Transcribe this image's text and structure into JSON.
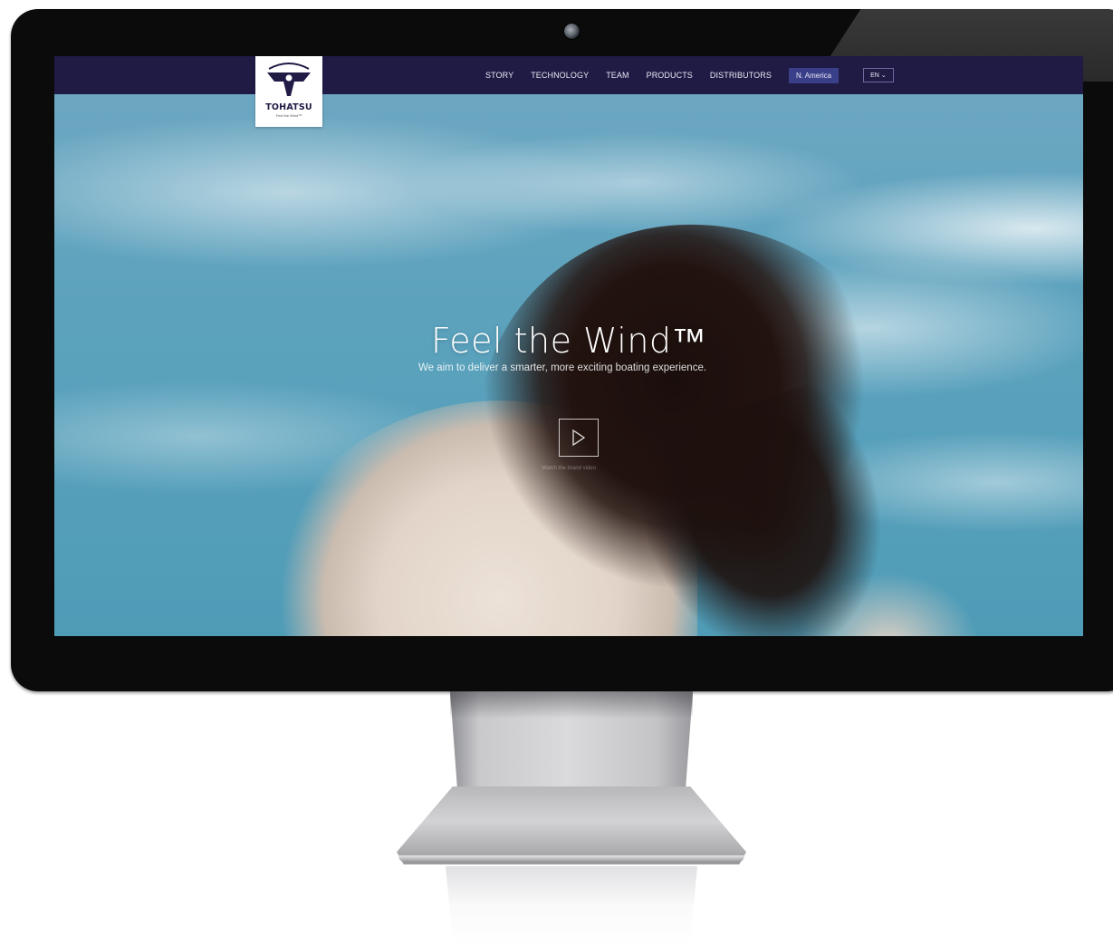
{
  "brand": {
    "name": "TOHATSU",
    "tagline": "Feel the Wind™"
  },
  "nav": {
    "links": [
      "STORY",
      "TECHNOLOGY",
      "TEAM",
      "PRODUCTS",
      "DISTRIBUTORS"
    ],
    "region": "N. America",
    "language": "EN ⌄"
  },
  "hero": {
    "title": "Feel the Wind™",
    "subtitle": "We aim to deliver a smarter, more exciting boating experience.",
    "play_caption": "Watch the brand video"
  },
  "colors": {
    "nav_background": "#201b45",
    "region_button": "#3a3f8a",
    "bezel": "#0b0b0b"
  },
  "icons": {
    "logo": "tohatsu-logo-icon",
    "play": "play-icon",
    "camera": "camera-icon"
  }
}
